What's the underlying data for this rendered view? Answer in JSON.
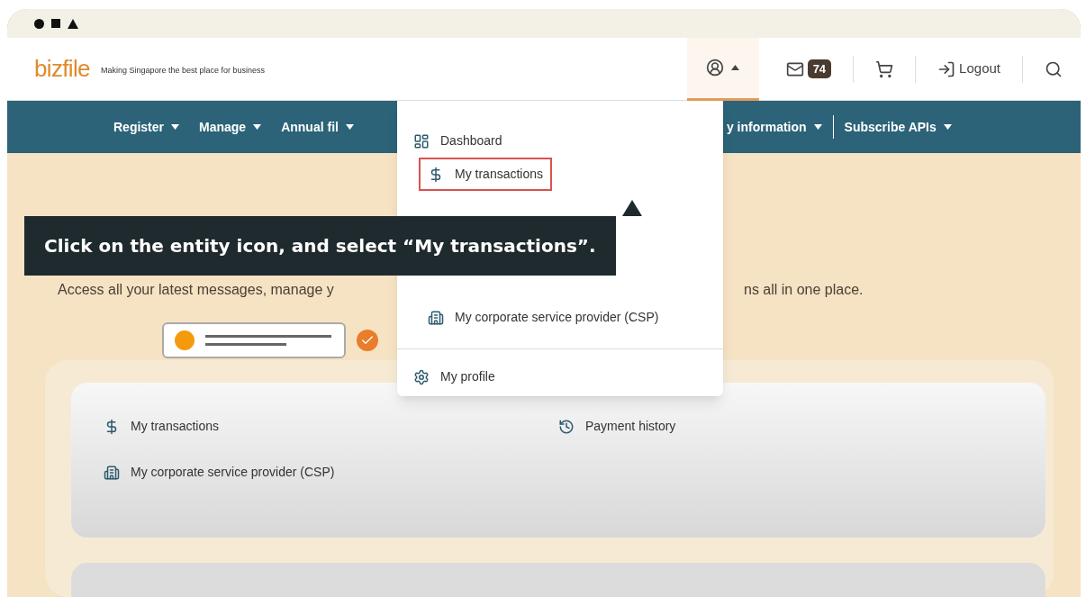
{
  "header": {
    "logo": "bizfile",
    "tagline": "Making Singapore the best place for business",
    "account_menu_open": true,
    "mail_count": "74",
    "logout": "Logout"
  },
  "nav": [
    {
      "label": "Register"
    },
    {
      "label": "Manage"
    },
    {
      "label": "Annual fil"
    },
    {
      "label": "y information"
    },
    {
      "label": "Subscribe APIs"
    }
  ],
  "account_menu": [
    {
      "label": "Dashboard",
      "kind": "dashboard",
      "highlighted": false
    },
    {
      "label": "My transactions",
      "kind": "dollar",
      "highlighted": true
    },
    {
      "label": "My corporate service provider (CSP)",
      "kind": "building",
      "highlighted": false
    },
    {
      "label": "My profile",
      "kind": "gear",
      "highlighted": false
    }
  ],
  "hero": {
    "subtitle_left": "Access all your latest messages, manage y",
    "subtitle_right": "ns all in one place."
  },
  "caption": "Click on the entity icon, and select “My transactions”.",
  "quick_links": [
    {
      "label": "My transactions",
      "kind": "dollar"
    },
    {
      "label": "Payment history",
      "kind": "history"
    },
    {
      "label": "My corporate service provider (CSP)",
      "kind": "building"
    }
  ]
}
